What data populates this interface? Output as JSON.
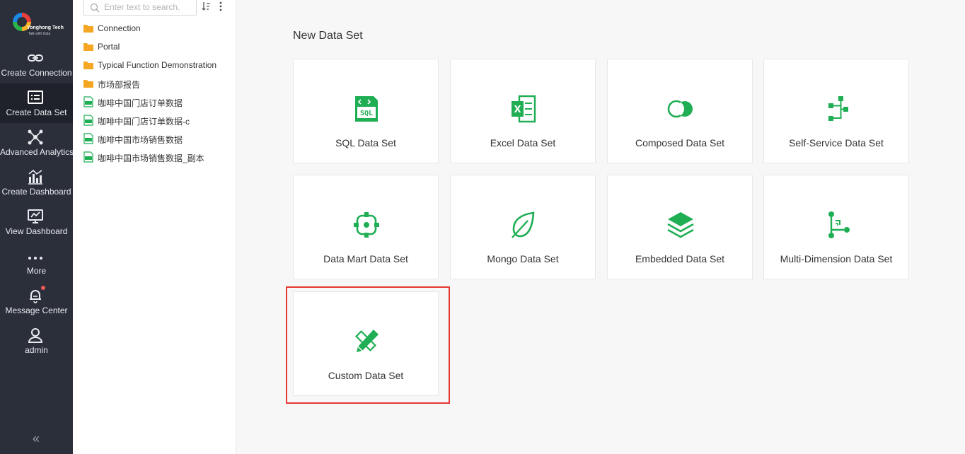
{
  "logo": {
    "brand": "Yonghong Tech",
    "tagline": "Talk with Data"
  },
  "nav": {
    "items": [
      {
        "label": "Create Connection",
        "icon": "link-icon"
      },
      {
        "label": "Create Data Set",
        "icon": "dataset-icon",
        "active": true
      },
      {
        "label": "Advanced Analytics",
        "icon": "network-icon"
      },
      {
        "label": "Create Dashboard",
        "icon": "bar-chart-icon"
      },
      {
        "label": "View Dashboard",
        "icon": "monitor-chart-icon"
      },
      {
        "label": "More",
        "icon": "more-dots-icon"
      },
      {
        "label": "Message Center",
        "icon": "bell-icon"
      },
      {
        "label": "admin",
        "icon": "user-icon"
      }
    ],
    "collapse_glyph": "«"
  },
  "tree": {
    "search_placeholder": "Enter text to search.",
    "items": [
      {
        "label": "Connection",
        "icon": "folder-icon"
      },
      {
        "label": "Portal",
        "icon": "folder-icon"
      },
      {
        "label": "Typical Function Demonstration",
        "icon": "folder-icon"
      },
      {
        "label": "市场部报告",
        "icon": "folder-icon"
      },
      {
        "label": "咖啡中国门店订单数据",
        "icon": "sql-file-icon"
      },
      {
        "label": "咖啡中国门店订单数据-c",
        "icon": "sql-file-icon"
      },
      {
        "label": "咖啡中国市场销售数据",
        "icon": "sql-file-icon"
      },
      {
        "label": "咖啡中国市场销售数据_副本",
        "icon": "sql-file-icon"
      }
    ]
  },
  "main": {
    "title": "New Data Set",
    "cards": [
      {
        "label": "SQL Data Set",
        "icon": "sql-icon"
      },
      {
        "label": "Excel Data Set",
        "icon": "excel-icon"
      },
      {
        "label": "Composed Data Set",
        "icon": "overlap-circles-icon"
      },
      {
        "label": "Self-Service Data Set",
        "icon": "flow-icon"
      },
      {
        "label": "Data Mart Data Set",
        "icon": "target-icon"
      },
      {
        "label": "Mongo Data Set",
        "icon": "leaf-icon"
      },
      {
        "label": "Embedded Data Set",
        "icon": "layers-icon"
      },
      {
        "label": "Multi-Dimension Data Set",
        "icon": "dimension-icon"
      },
      {
        "label": "Custom Data Set",
        "icon": "pencil-ruler-icon"
      }
    ]
  },
  "colors": {
    "accent": "#1fae54",
    "nav_bg": "#2b2f3a",
    "highlight": "#e53935",
    "folder": "#f5a623"
  }
}
